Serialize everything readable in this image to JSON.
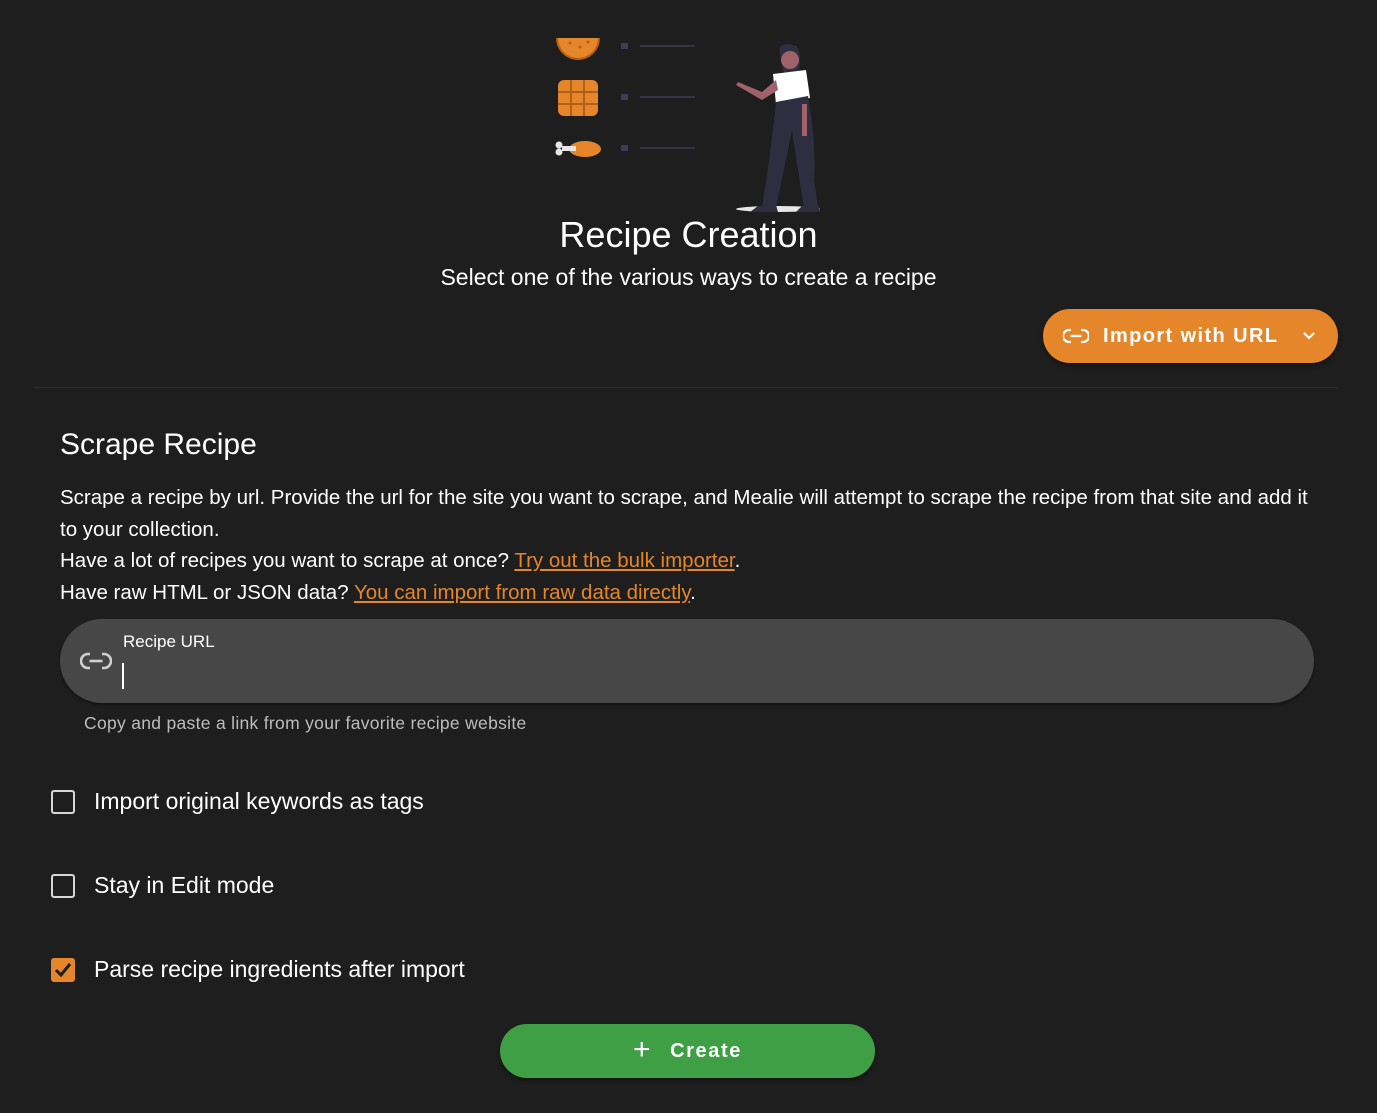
{
  "header": {
    "title": "Recipe Creation",
    "subtitle": "Select one of the various ways to create a recipe"
  },
  "import_menu": {
    "label": "Import with URL",
    "icon": "link-icon",
    "dropdown_icon": "chevron-down-icon"
  },
  "scrape": {
    "title": "Scrape Recipe",
    "description": "Scrape a recipe by url. Provide the url for the site you want to scrape, and Mealie will attempt to scrape the recipe from that site and add it to your collection.",
    "bulk_prompt": "Have a lot of recipes you want to scrape at once? ",
    "bulk_link": "Try out the bulk importer",
    "raw_prompt": "Have raw HTML or JSON data? ",
    "raw_link": "You can import from raw data directly",
    "period": "."
  },
  "url_field": {
    "label": "Recipe URL",
    "value": "",
    "hint": "Copy and paste a link from your favorite recipe website"
  },
  "options": [
    {
      "label": "Import original keywords as tags",
      "checked": false
    },
    {
      "label": "Stay in Edit mode",
      "checked": false
    },
    {
      "label": "Parse recipe ingredients after import",
      "checked": true
    }
  ],
  "create_button": {
    "label": "Create",
    "icon": "plus-icon"
  },
  "colors": {
    "background": "#1e1e1e",
    "accent": "#e6862a",
    "success": "#3e9f45",
    "field": "#474747"
  }
}
